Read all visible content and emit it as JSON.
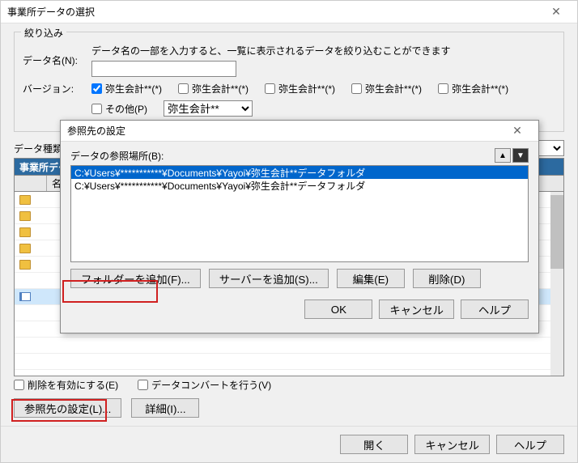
{
  "mainWindow": {
    "title": "事業所データの選択",
    "filterLegend": "絞り込み",
    "dataNameLabel": "データ名(N):",
    "filterHint": "データ名の一部を入力すると、一覧に表示されるデータを絞り込むことができます",
    "versionLabel": "バージョン:",
    "versionChecks": [
      "弥生会計**(*)",
      "弥生会計**(*)",
      "弥生会計**(*)",
      "弥生会計**(*)",
      "弥生会計**(*)"
    ],
    "otherLabel": "その他(P)",
    "otherCombo": "弥生会計**",
    "dataKindLabel": "データ種類(K):",
    "tableHeader": "事業所データ",
    "tableSub": "名前",
    "dataKindIcon": "▼",
    "deleteEnableLabel": "削除を有効にする(E)",
    "convertLabel": "データコンバートを行う(V)",
    "refSettingsBtn": "参照先の設定(L)...",
    "detailBtn": "詳細(I)...",
    "openBtn": "開く",
    "cancelBtn": "キャンセル",
    "helpBtn": "ヘルプ"
  },
  "modal": {
    "title": "参照先の設定",
    "listLabel": "データの参照場所(B):",
    "items": [
      "C:¥Users¥***********¥Documents¥Yayoi¥弥生会計**データフォルダ",
      "C:¥Users¥***********¥Documents¥Yayoi¥弥生会計**データフォルダ"
    ],
    "addFolderBtn": "フォルダーを追加(F)...",
    "addServerBtn": "サーバーを追加(S)...",
    "editBtn": "編集(E)",
    "deleteBtn": "削除(D)",
    "okBtn": "OK",
    "cancelBtn": "キャンセル",
    "helpBtn": "ヘルプ",
    "upIcon": "▲",
    "downIcon": "▼"
  }
}
